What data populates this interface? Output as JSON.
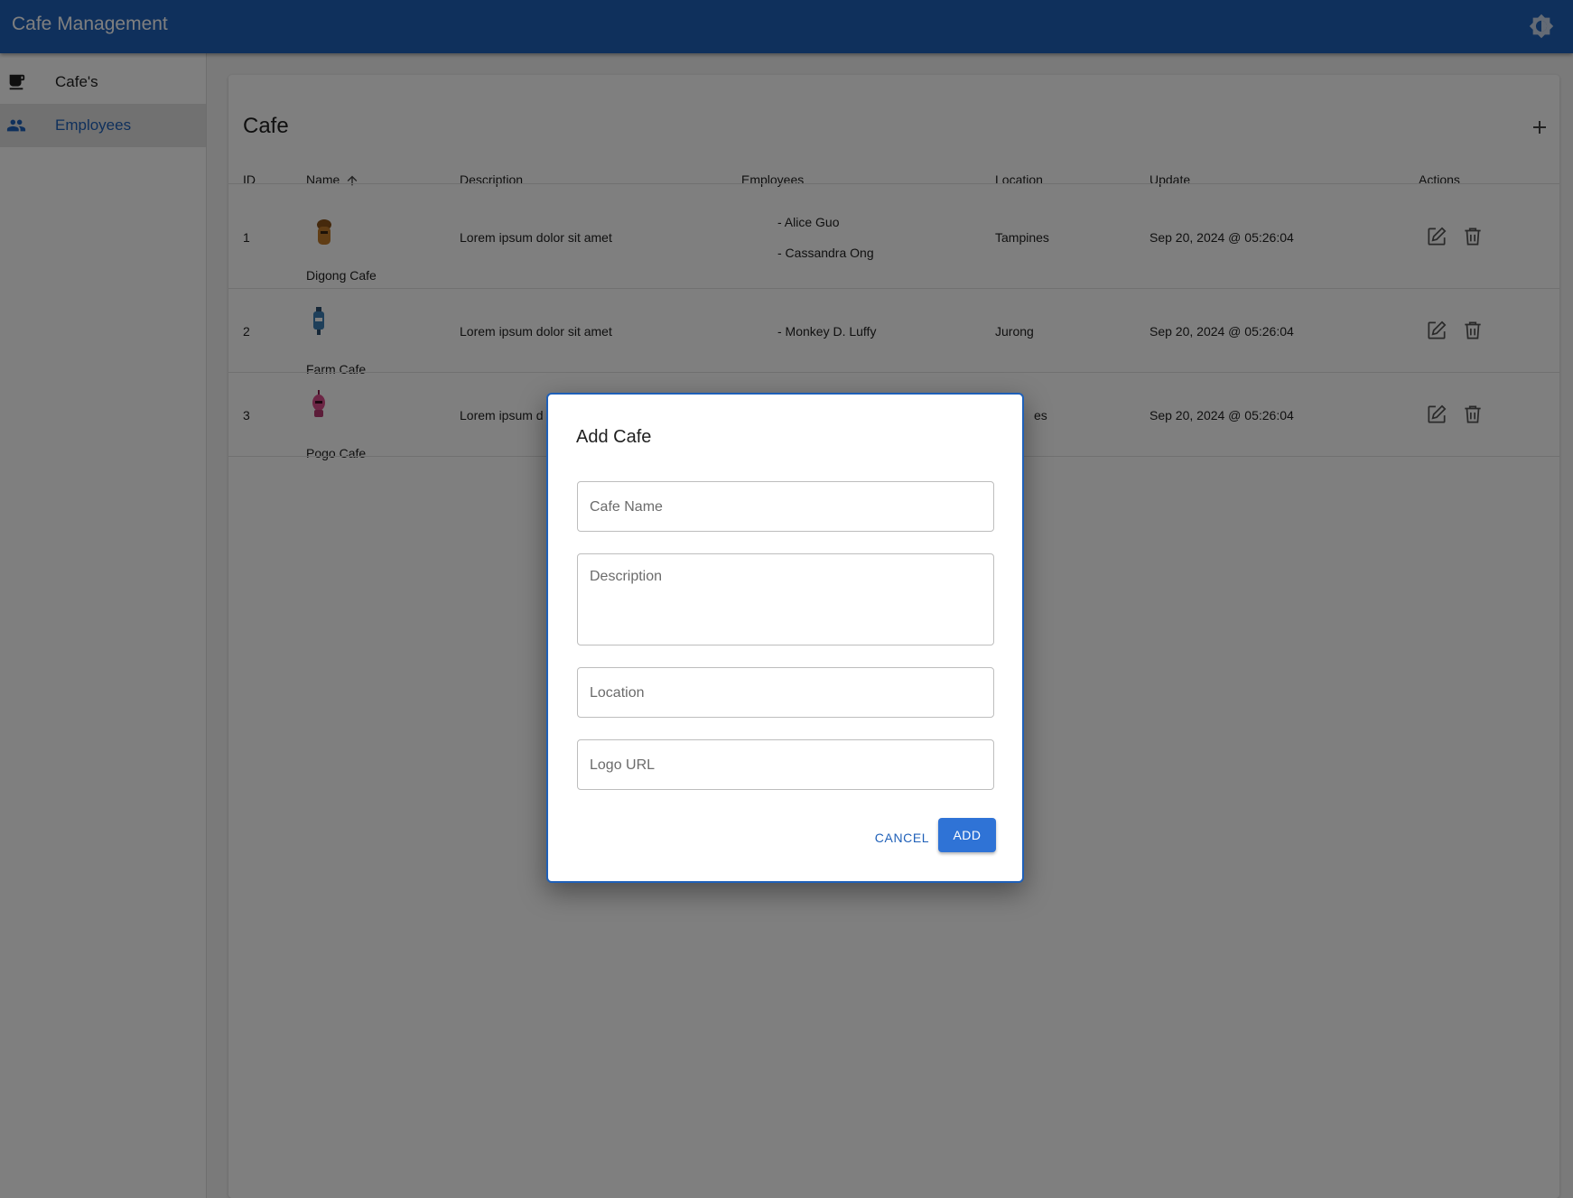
{
  "app": {
    "title": "Cafe Management",
    "theme_toggle_icon": "brightness-icon"
  },
  "sidebar": {
    "items": [
      {
        "label": "Cafe's",
        "icon": "coffee-cup-icon",
        "active": false
      },
      {
        "label": "Employees",
        "icon": "people-icon",
        "active": true
      }
    ]
  },
  "main": {
    "title": "Cafe",
    "add_icon": "plus-icon",
    "columns": {
      "id": "ID",
      "name": "Name",
      "description": "Description",
      "employees": "Employees",
      "location": "Location",
      "update": "Update",
      "actions": "Actions"
    },
    "sort": {
      "column": "name",
      "direction": "ascending"
    },
    "rows": [
      {
        "id": "1",
        "name": "Digong Cafe",
        "description": "Lorem ipsum dolor sit amet",
        "employees": [
          "- Alice Guo",
          "- Cassandra Ong"
        ],
        "location": "Tampines",
        "update": "Sep 20, 2024 @ 05:26:04",
        "logo_color": "#c07a2a"
      },
      {
        "id": "2",
        "name": "Farm Cafe",
        "description": "Lorem ipsum dolor sit amet",
        "employees": [
          "- Monkey D. Luffy"
        ],
        "location": "Jurong",
        "update": "Sep 20, 2024 @ 05:26:04",
        "logo_color": "#3d7fb5"
      },
      {
        "id": "3",
        "name": "Pogo Cafe",
        "description": "Lorem ipsum d",
        "employees": [],
        "location": "es",
        "update": "Sep 20, 2024 @ 05:26:04",
        "logo_color": "#d94d8a"
      }
    ]
  },
  "dialog": {
    "title": "Add Cafe",
    "fields": {
      "cafe_name": {
        "placeholder": "Cafe Name",
        "value": ""
      },
      "description": {
        "placeholder": "Description",
        "value": ""
      },
      "location": {
        "placeholder": "Location",
        "value": ""
      },
      "logo_url": {
        "placeholder": "Logo URL",
        "value": ""
      }
    },
    "cancel_label": "CANCEL",
    "add_label": "ADD"
  },
  "colors": {
    "primary": "#1f60b8",
    "button": "#2f73d6",
    "overlay": "rgba(0,0,0,0.5)"
  }
}
